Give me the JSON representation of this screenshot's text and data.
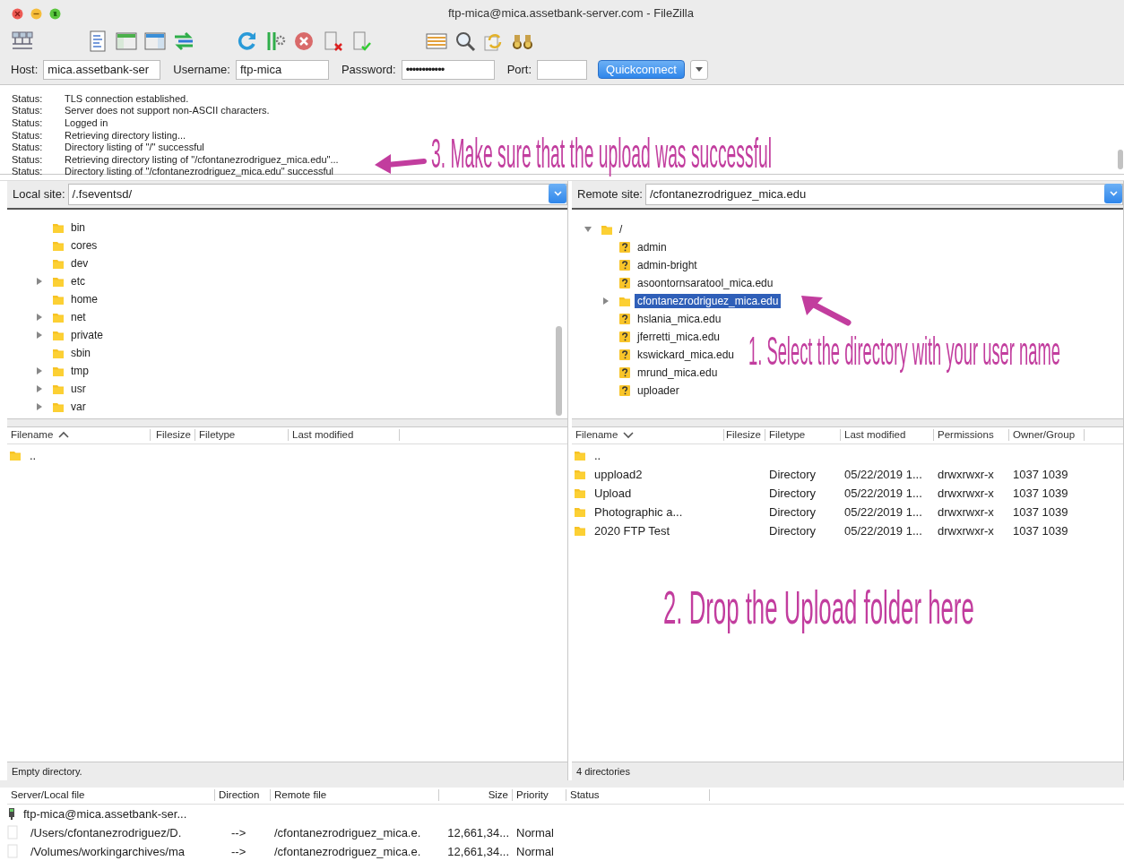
{
  "window": {
    "title": "ftp-mica@mica.assetbank-server.com - FileZilla"
  },
  "quickconnect": {
    "host_label": "Host:",
    "host": "mica.assetbank-ser",
    "username_label": "Username:",
    "username": "ftp-mica",
    "password_label": "Password:",
    "password": "••••••••••••",
    "port_label": "Port:",
    "button": "Quickconnect"
  },
  "message_log": [
    {
      "label": "Status:",
      "text": "TLS connection established."
    },
    {
      "label": "Status:",
      "text": "Server does not support non-ASCII characters."
    },
    {
      "label": "Status:",
      "text": "Logged in"
    },
    {
      "label": "Status:",
      "text": "Retrieving directory listing..."
    },
    {
      "label": "Status:",
      "text": "Directory listing of \"/\" successful"
    },
    {
      "label": "Status:",
      "text": "Retrieving directory listing of \"/cfontanezrodriguez_mica.edu\"..."
    },
    {
      "label": "Status:",
      "text": "Directory listing of \"/cfontanezrodriguez_mica.edu\" successful"
    }
  ],
  "local": {
    "site_label": "Local site:",
    "path": "/.fseventsd/",
    "tree": [
      {
        "name": "bin",
        "kind": "folder",
        "selected": false
      },
      {
        "name": "cores",
        "kind": "folder",
        "selected": false
      },
      {
        "name": "dev",
        "kind": "folder",
        "selected": false
      },
      {
        "name": "etc",
        "kind": "folder",
        "selected": false,
        "expanded": false
      },
      {
        "name": "home",
        "kind": "folder",
        "selected": false
      },
      {
        "name": "net",
        "kind": "folder",
        "selected": false,
        "expanded": false
      },
      {
        "name": "private",
        "kind": "folder",
        "selected": false,
        "expanded": false
      },
      {
        "name": "sbin",
        "kind": "folder",
        "selected": false
      },
      {
        "name": "tmp",
        "kind": "folder",
        "selected": false,
        "expanded": false
      },
      {
        "name": "usr",
        "kind": "folder",
        "selected": false,
        "expanded": false
      },
      {
        "name": "var",
        "kind": "folder",
        "selected": false,
        "expanded": false
      }
    ],
    "columns": [
      {
        "label": "Filename",
        "kind": "sorted-up"
      },
      {
        "label": "Filesize",
        "kind": "plain"
      },
      {
        "label": "Filetype",
        "kind": "plain"
      },
      {
        "label": "Last modified",
        "kind": "plain"
      }
    ],
    "rows": [
      {
        "cells": [
          ".."
        ]
      }
    ],
    "status": "Empty directory."
  },
  "remote": {
    "site_label": "Remote site:",
    "path": "/cfontanezrodriguez_mica.edu",
    "tree": [
      {
        "name": "/",
        "kind": "folder",
        "selected": false,
        "expanded": true,
        "children": [
          {
            "name": "admin",
            "kind": "unknown",
            "selected": false
          },
          {
            "name": "admin-bright",
            "kind": "unknown",
            "selected": false
          },
          {
            "name": "asoontornsaratool_mica.edu",
            "kind": "unknown",
            "selected": false
          },
          {
            "name": "cfontanezrodriguez_mica.edu",
            "kind": "folder",
            "selected": true,
            "expanded": false
          },
          {
            "name": "hslania_mica.edu",
            "kind": "unknown",
            "selected": false
          },
          {
            "name": "jferretti_mica.edu",
            "kind": "unknown",
            "selected": false
          },
          {
            "name": "kswickard_mica.edu",
            "kind": "unknown",
            "selected": false
          },
          {
            "name": "mrund_mica.edu",
            "kind": "unknown",
            "selected": false
          },
          {
            "name": "uploader",
            "kind": "unknown",
            "selected": false
          }
        ]
      }
    ],
    "columns": [
      {
        "label": "Filename",
        "kind": "sorted-down"
      },
      {
        "label": "Filesize",
        "kind": "plain"
      },
      {
        "label": "Filetype",
        "kind": "plain"
      },
      {
        "label": "Last modified",
        "kind": "plain"
      },
      {
        "label": "Permissions",
        "kind": "plain"
      },
      {
        "label": "Owner/Group",
        "kind": "plain"
      }
    ],
    "rows": [
      {
        "cells": [
          ".."
        ]
      },
      {
        "cells": [
          "uppload2",
          "",
          "Directory",
          "05/22/2019 1...",
          "drwxrwxr-x",
          "1037 1039"
        ]
      },
      {
        "cells": [
          "Upload",
          "",
          "Directory",
          "05/22/2019 1...",
          "drwxrwxr-x",
          "1037 1039"
        ]
      },
      {
        "cells": [
          "Photographic a...",
          "",
          "Directory",
          "05/22/2019 1...",
          "drwxrwxr-x",
          "1037 1039"
        ]
      },
      {
        "cells": [
          "2020 FTP Test",
          "",
          "Directory",
          "05/22/2019 1...",
          "drwxrwxr-x",
          "1037 1039"
        ]
      }
    ],
    "status": "4 directories"
  },
  "queue": {
    "columns": [
      "Server/Local file",
      "Direction",
      "Remote file",
      "Size",
      "Priority",
      "Status"
    ],
    "rows": [
      {
        "kind": "server",
        "cells": [
          "ftp-mica@mica.assetbank-ser..."
        ]
      },
      {
        "kind": "file",
        "cells": [
          "/Users/cfontanezrodriguez/D.",
          "-->",
          "/cfontanezrodriguez_mica.e.",
          "12,661,34...",
          "Normal"
        ]
      },
      {
        "kind": "file",
        "cells": [
          "/Volumes/workingarchives/ma",
          "-->",
          "/cfontanezrodriguez_mica.e.",
          "12,661,34...",
          "Normal"
        ]
      }
    ]
  },
  "annotations": [
    {
      "text": "3. Make sure that the upload was successful",
      "kind": "left-arrow"
    },
    {
      "text": "1. Select the directory with your user name",
      "kind": "up-left-arrow"
    },
    {
      "text": "2. Drop the Upload folder here",
      "kind": "plain"
    }
  ]
}
